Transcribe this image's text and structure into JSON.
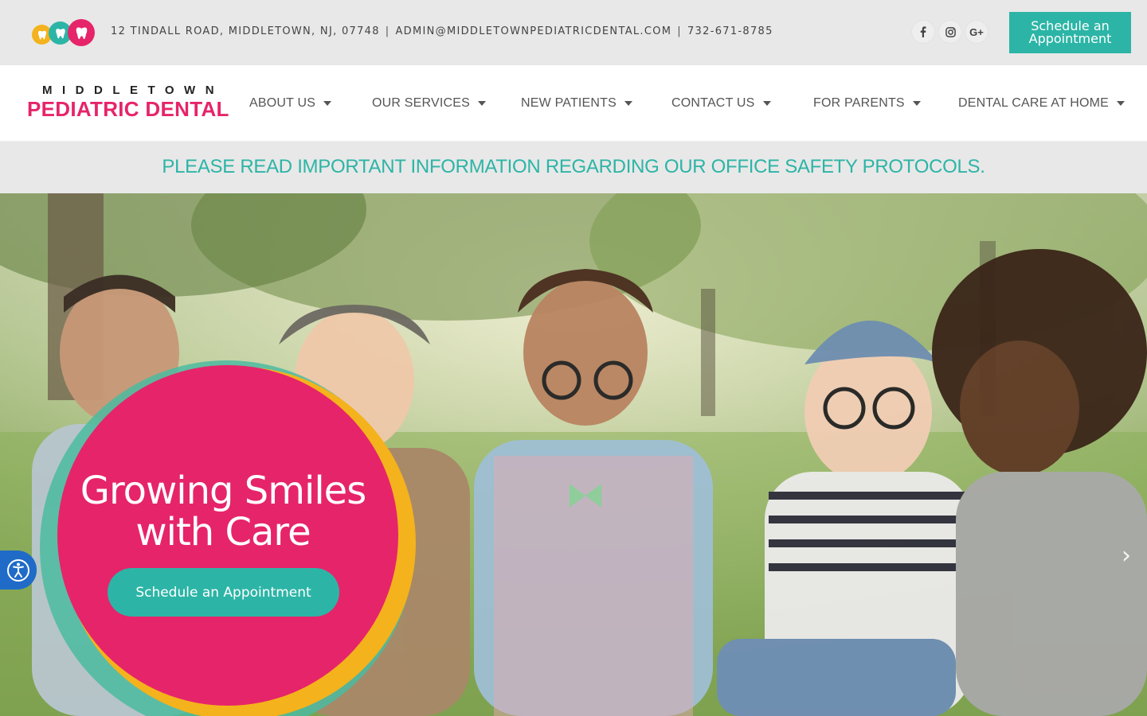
{
  "topbar": {
    "address": "12 TINDALL ROAD, MIDDLETOWN, NJ, 07748",
    "email": "ADMIN@MIDDLETOWNPEDIATRICDENTAL.COM",
    "phone": "732-671-8785",
    "separator": "|",
    "social": [
      {
        "icon": "facebook-icon",
        "glyph": "f"
      },
      {
        "icon": "instagram-icon",
        "glyph": ""
      },
      {
        "icon": "google-plus-icon",
        "glyph": "G+"
      }
    ],
    "cta_label": "Schedule an Appointment"
  },
  "logo": {
    "line1": "MIDDLETOWN",
    "line2": "PEDIATRIC DENTAL"
  },
  "nav": {
    "items": [
      {
        "label": "ABOUT US"
      },
      {
        "label": "OUR SERVICES"
      },
      {
        "label": "NEW PATIENTS"
      },
      {
        "label": "CONTACT US"
      },
      {
        "label": "FOR PARENTS"
      },
      {
        "label": "DENTAL CARE AT HOME"
      }
    ]
  },
  "notice": {
    "text": "PLEASE READ IMPORTANT INFORMATION REGARDING OUR OFFICE SAFETY PROTOCOLS."
  },
  "hero": {
    "headline": "Growing Smiles with Care",
    "cta_label": "Schedule an Appointment",
    "prev_arrow": "‹",
    "next_arrow": "›"
  },
  "colors": {
    "brand_pink": "#e6246a",
    "brand_teal": "#2cb5a6",
    "brand_orange": "#f4b21c",
    "accessibility_blue": "#1f6bc7"
  }
}
